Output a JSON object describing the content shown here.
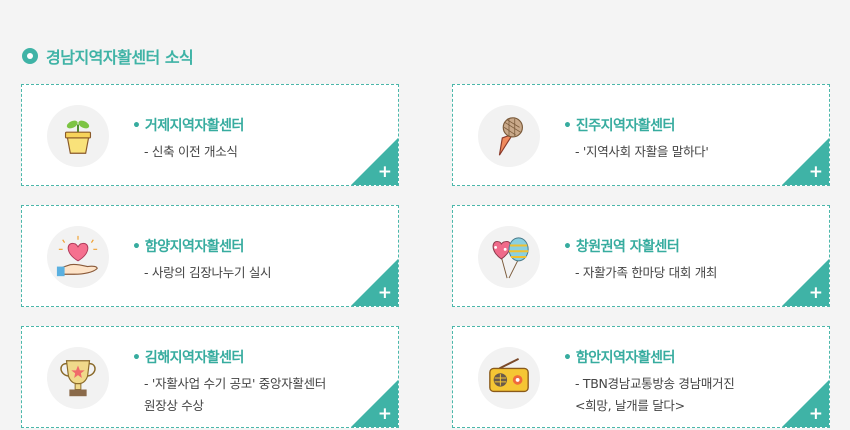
{
  "section": {
    "title": "경남지역자활센터 소식"
  },
  "colors": {
    "accent": "#3fb3a6",
    "text": "#444444"
  },
  "cards": [
    {
      "title": "거제지역자활센터",
      "desc": [
        "- 신축 이전 개소식"
      ],
      "icon": "plant-pot-icon",
      "more": "+"
    },
    {
      "title": "진주지역자활센터",
      "desc": [
        "- '지역사회 자활을 말하다'"
      ],
      "icon": "microphone-icon",
      "more": "+"
    },
    {
      "title": "함양지역자활센터",
      "desc": [
        "- 사랑의 김장나누기 실시"
      ],
      "icon": "heart-hand-icon",
      "more": "+"
    },
    {
      "title": "창원권역 자활센터",
      "desc": [
        "- 자활가족 한마당 대회 개최"
      ],
      "icon": "balloons-icon",
      "more": "+"
    },
    {
      "title": "김해지역자활센터",
      "desc": [
        "- '자활사업 수기 공모' 중앙자활센터",
        "원장상 수상"
      ],
      "icon": "trophy-icon",
      "more": "+"
    },
    {
      "title": "함안지역자활센터",
      "desc": [
        "- TBN경남교통방송 경남매거진",
        "<희망, 날개를 달다>"
      ],
      "icon": "radio-icon",
      "more": "+"
    }
  ]
}
